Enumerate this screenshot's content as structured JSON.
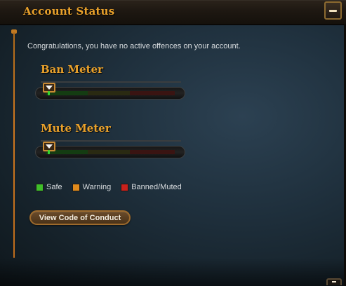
{
  "window": {
    "title": "Account Status"
  },
  "main": {
    "message": "Congratulations, you have no active offences on your account."
  },
  "meters": [
    {
      "heading": "Ban Meter",
      "level": 0.0
    },
    {
      "heading": "Mute Meter",
      "level": 0.0
    }
  ],
  "legend": [
    {
      "label": "Safe",
      "color": "#3fbf2a"
    },
    {
      "label": "Warning",
      "color": "#e08a1c"
    },
    {
      "label": "Banned/Muted",
      "color": "#c9211c"
    }
  ],
  "buttons": {
    "code_of_conduct": "View Code of Conduct"
  },
  "icons": {
    "minimize": "minimize-icon",
    "meter_marker": "marker-arrow-icon"
  },
  "colors": {
    "accent_gold": "#e9a12b",
    "text": "#d8dcdf",
    "panel_bg": "#1f303d"
  }
}
